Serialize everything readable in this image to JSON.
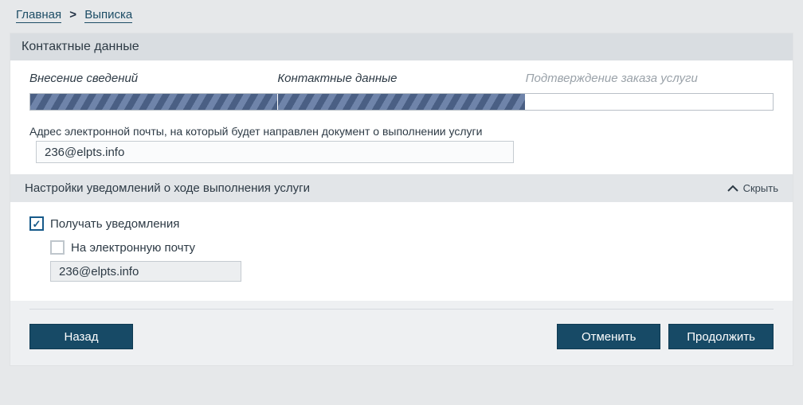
{
  "breadcrumb": {
    "home": "Главная",
    "current": "Выписка"
  },
  "cardTitle": "Контактные данные",
  "steps": [
    {
      "label": "Внесение сведений",
      "active": true
    },
    {
      "label": "Контактные данные",
      "active": true
    },
    {
      "label": "Подтверждение заказа услуги",
      "active": false
    }
  ],
  "emailField": {
    "label": "Адрес электронной почты, на который будет направлен документ о выполнении услуги",
    "value": "236@elpts.info"
  },
  "notifSection": {
    "title": "Настройки уведомлений о ходе выполнения услуги",
    "toggle": "Скрыть",
    "receive": {
      "label": "Получать уведомления",
      "checked": true
    },
    "byEmail": {
      "label": "На электронную почту",
      "checked": false,
      "value": "236@elpts.info"
    }
  },
  "buttons": {
    "back": "Назад",
    "cancel": "Отменить",
    "continue": "Продолжить"
  }
}
